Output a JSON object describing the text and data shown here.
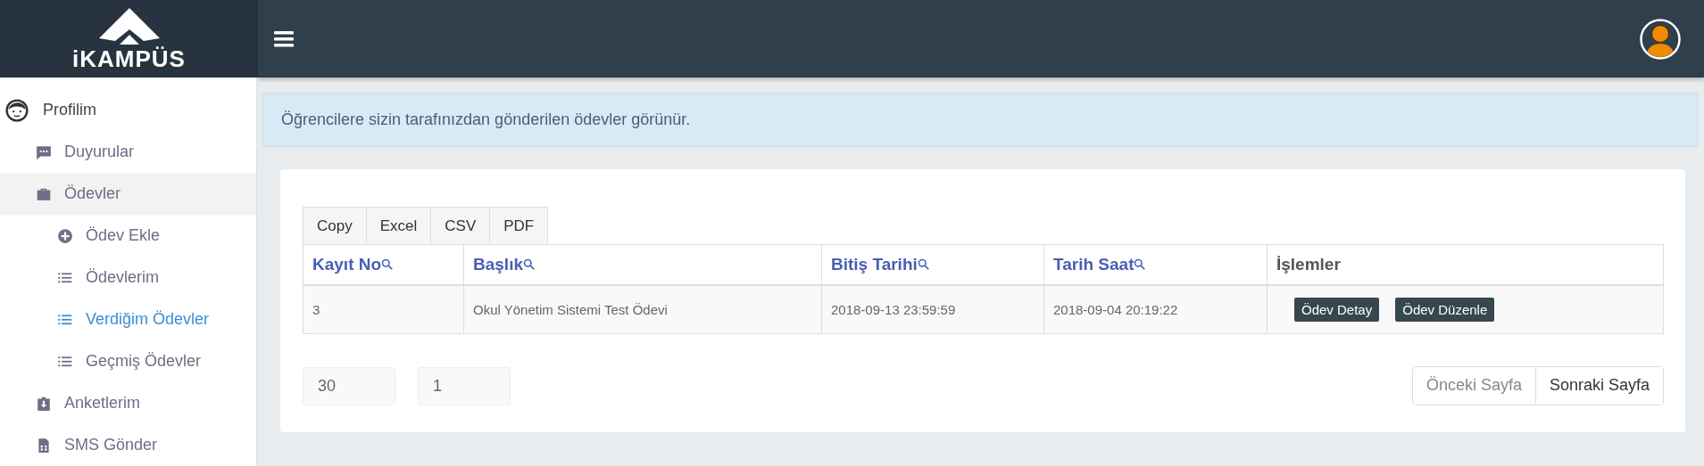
{
  "header": {
    "logo_text": "iKAMPÜS"
  },
  "sidebar": {
    "items": [
      {
        "label": "Profilim",
        "kind": "profile",
        "selected": false
      },
      {
        "label": "Duyurular",
        "kind": "menu",
        "selected": false
      },
      {
        "label": "Ödevler",
        "kind": "menu",
        "selected": false,
        "expanded": true,
        "children": [
          {
            "label": "Ödev Ekle",
            "kind": "menu",
            "selected": false
          },
          {
            "label": "Ödevlerim",
            "kind": "menu",
            "selected": false
          },
          {
            "label": "Verdiğim Ödevler",
            "kind": "menu",
            "selected": true
          },
          {
            "label": "Geçmiş Ödevler",
            "kind": "menu",
            "selected": false
          }
        ]
      },
      {
        "label": "Anketlerim",
        "kind": "menu",
        "selected": false
      },
      {
        "label": "SMS Gönder",
        "kind": "menu",
        "selected": false
      }
    ]
  },
  "alert": {
    "text": "Öğrencilere sizin tarafınızdan gönderilen ödevler görünür."
  },
  "export_buttons": [
    "Copy",
    "Excel",
    "CSV",
    "PDF"
  ],
  "table": {
    "columns": [
      {
        "label": "Kayıt No",
        "searchable": true
      },
      {
        "label": "Başlık",
        "searchable": true
      },
      {
        "label": "Bitiş Tarihi",
        "searchable": true
      },
      {
        "label": "Tarih Saat",
        "searchable": true
      },
      {
        "label": "İşlemler",
        "searchable": false
      }
    ],
    "rows": [
      {
        "cells": [
          "3",
          "Okul Yönetim Sistemi Test Ödevi",
          "2018-09-13 23:59:59",
          "2018-09-04 20:19:22"
        ],
        "actions": [
          "Ödev Detay",
          "Ödev Düzenle"
        ]
      }
    ]
  },
  "paging": {
    "page_size": "30",
    "page": "1",
    "buttons": [
      {
        "label": "Önceki Sayfa",
        "disabled": true
      },
      {
        "label": "Sonraki Sayfa",
        "disabled": false
      }
    ]
  }
}
